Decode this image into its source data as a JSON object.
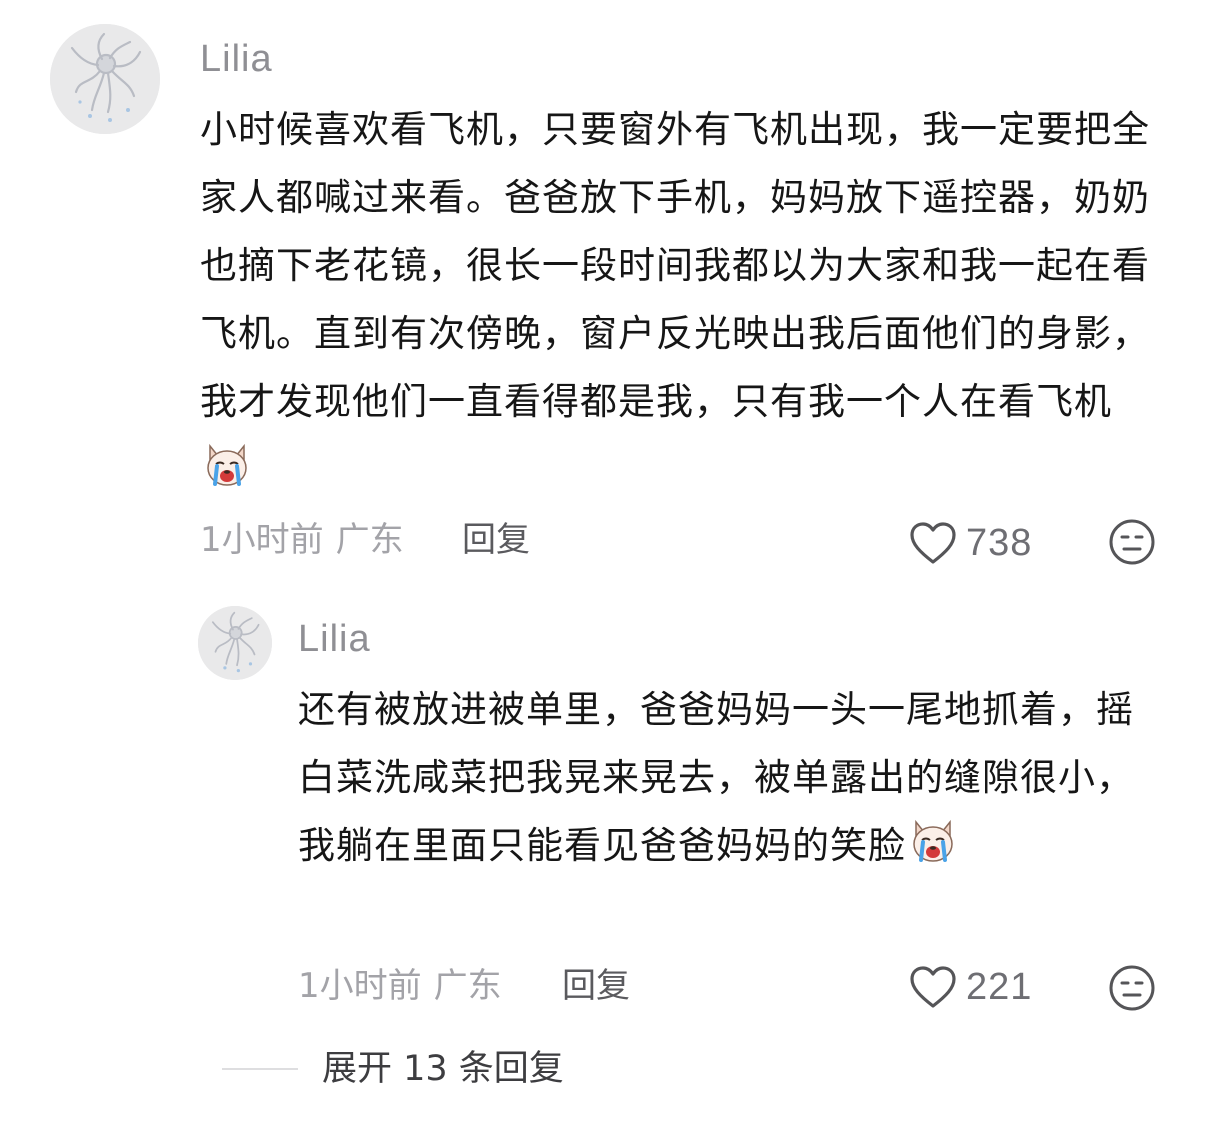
{
  "comment": {
    "username": "Lilia",
    "text": "小时候喜欢看飞机，只要窗外有飞机出现，我一定要把全家人都喊过来看。爸爸放下手机，妈妈放下遥控器，奶奶也摘下老花镜，很长一段时间我都以为大家和我一起在看飞机。直到有次傍晚，窗户反光映出我后面他们的身影，我才发现他们一直看得都是我，只有我一个人在看飞机",
    "emoji_icon": "crying-dog-emoji-icon",
    "time": "1小时前",
    "location": "广东",
    "reply_label": "回复",
    "likes": "738"
  },
  "reply": {
    "username": "Lilia",
    "text": "还有被放进被单里，爸爸妈妈一头一尾地抓着，摇白菜洗咸菜把我晃来晃去，被单露出的缝隙很小，我躺在里面只能看见爸爸妈妈的笑脸",
    "emoji_icon": "crying-dog-emoji-icon",
    "time": "1小时前",
    "location": "广东",
    "reply_label": "回复",
    "likes": "221"
  },
  "expand_replies": {
    "label": "展开 13 条回复"
  },
  "colors": {
    "username": "#8f8f94",
    "body_text": "#161616",
    "meta": "#a3a3a8",
    "reply_button": "#5a5a5e",
    "icon_stroke": "#555558",
    "background": "#ffffff"
  }
}
